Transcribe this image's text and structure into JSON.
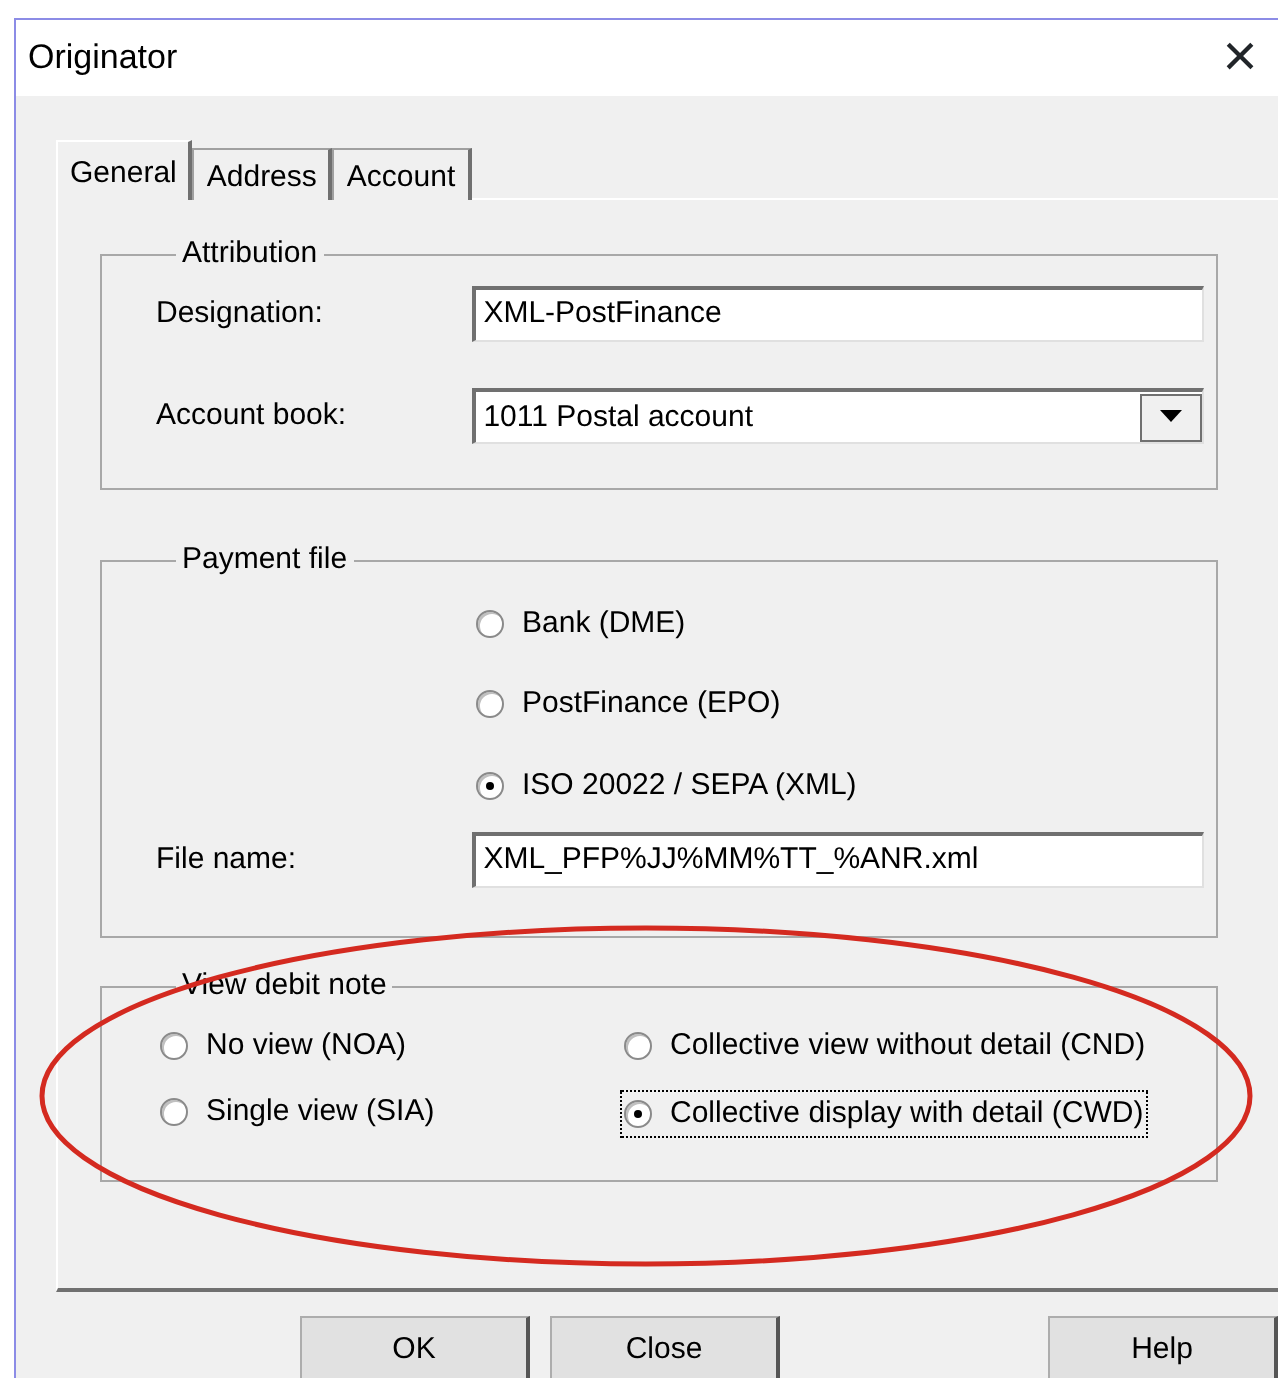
{
  "window": {
    "title": "Originator",
    "close": "×"
  },
  "tabs": [
    {
      "label": "General",
      "selected": true
    },
    {
      "label": "Address",
      "selected": false
    },
    {
      "label": "Account",
      "selected": false
    }
  ],
  "attribution": {
    "legend": "Attribution",
    "designation": {
      "label": "Designation:",
      "value": "XML-PostFinance"
    },
    "account_book": {
      "label": "Account book:",
      "value": "1011 Postal account"
    }
  },
  "payment_file": {
    "legend": "Payment file",
    "options": [
      {
        "label": "Bank (DME)",
        "selected": false
      },
      {
        "label": "PostFinance (EPO)",
        "selected": false
      },
      {
        "label": "ISO 20022 / SEPA (XML)",
        "selected": true
      }
    ],
    "file_name": {
      "label": "File name:",
      "value": "XML_PFP%JJ%MM%TT_%ANR.xml"
    }
  },
  "view_debit_note": {
    "legend": "View debit note",
    "options": [
      {
        "label": "No view (NOA)",
        "selected": false,
        "focused": false
      },
      {
        "label": "Collective view without detail (CND)",
        "selected": false,
        "focused": false
      },
      {
        "label": "Single view (SIA)",
        "selected": false,
        "focused": false
      },
      {
        "label": "Collective display with detail (CWD)",
        "selected": true,
        "focused": true
      }
    ]
  },
  "annotation": {
    "kind": "ellipse",
    "color": "#d42a20"
  },
  "buttons": [
    {
      "label": "OK",
      "kind": "left"
    },
    {
      "label": "Close",
      "kind": "left"
    },
    {
      "label": "Help",
      "kind": "right"
    }
  ]
}
